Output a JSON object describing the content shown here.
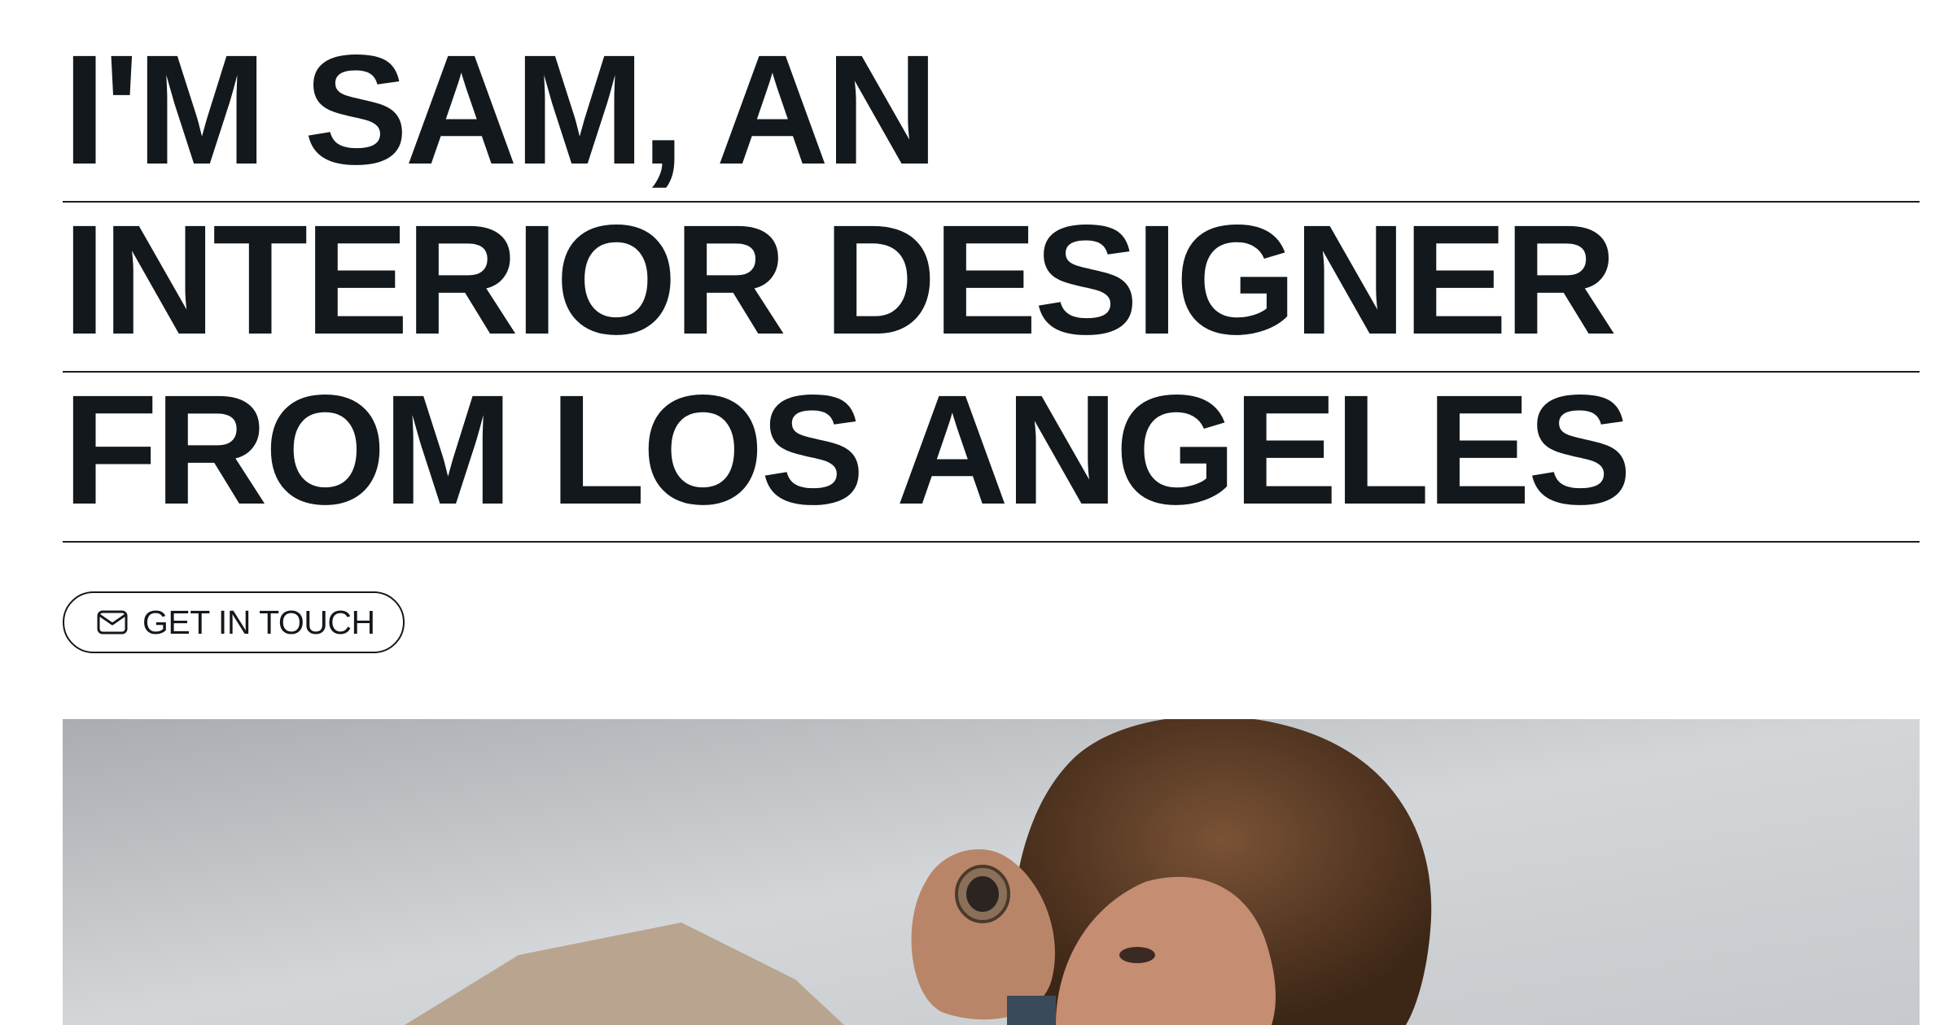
{
  "hero": {
    "lines": [
      "I'M SAM, AN",
      "INTERIOR DESIGNER",
      "FROM LOS ANGELES"
    ]
  },
  "cta": {
    "label": "GET IN TOUCH",
    "icon": "mail-icon"
  },
  "photo": {
    "subject": "portrait-photo"
  },
  "colors": {
    "text": "#12181c",
    "background": "#ffffff",
    "rule": "#1b1f22"
  }
}
